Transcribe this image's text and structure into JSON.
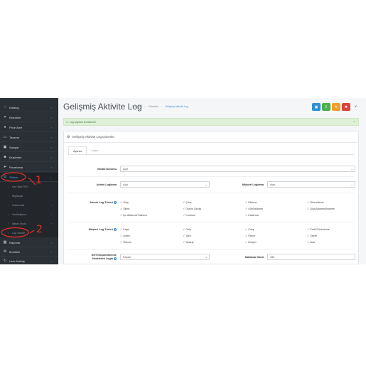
{
  "sidebar": {
    "items": [
      {
        "label": "Katalog",
        "icon": "tag-icon"
      },
      {
        "label": "Eklentiler",
        "icon": "puzzle-icon"
      },
      {
        "label": "Price Alert",
        "icon": "bell-icon"
      },
      {
        "label": "Tasarım",
        "icon": "monitor-icon"
      },
      {
        "label": "Satışlar",
        "icon": "cart-icon"
      },
      {
        "label": "Müşteriler",
        "icon": "user-icon"
      },
      {
        "label": "Pazarlama",
        "icon": "share-icon"
      },
      {
        "label": "Sistem",
        "icon": "gear-icon"
      }
    ],
    "sub_items": [
      {
        "label": "Key Yard PRO"
      },
      {
        "label": "Bilgisayar"
      },
      {
        "label": "Kullanıcılar"
      },
      {
        "label": "Yerelleştirme"
      },
      {
        "label": "Bakım Modu"
      },
      {
        "label": "Log Yazılım"
      }
    ],
    "bottom_items": [
      {
        "label": "Raporlar",
        "icon": "bar-chart-icon"
      },
      {
        "label": "Modüller",
        "icon": "gear-icon"
      },
      {
        "label": "User Activity",
        "icon": "history-icon"
      }
    ]
  },
  "header": {
    "title": "Gelişmiş Aktivite Log",
    "breadcrumb": [
      "Anasayfa",
      "Eklentiler",
      "Gelişmiş Aktivite Log"
    ]
  },
  "alert": {
    "text": "Log kayıtları temizlendi!"
  },
  "panel": {
    "title": "Gelişmiş Aktivite Log Düzenle"
  },
  "tabs": [
    {
      "label": "Ayarlar"
    },
    {
      "label": "Loglar"
    }
  ],
  "form": {
    "module_status": {
      "label": "Modül Durumu",
      "value": "Açık"
    },
    "admin_logging": {
      "label": "Admin Loglama",
      "value": "Açık"
    },
    "customer_logging": {
      "label": "Müşteri Loglama",
      "value": "Açık"
    },
    "admin_log_types": {
      "label": "Admin Log Türleri",
      "options": [
        "Giriş",
        "Çıkış",
        "Ekleme",
        "Güncelleme",
        "Silme",
        "Durum Geçişi",
        "Görüntüleme",
        "Dışa Aktarma/İndirme",
        "İçe Aktarma/Yükleme",
        "Kurulum",
        "Kaldırma"
      ]
    },
    "customer_log_types": {
      "label": "Müşteri Log Türleri",
      "options": [
        "Kayıt",
        "Giriş",
        "Çıkış",
        "Profil Düzenleme",
        "Adres",
        "Şifre",
        "Favori",
        "Sepet",
        "Ödeme",
        "Sipariş",
        "İletişim",
        "İade"
      ]
    },
    "get_post": {
      "label_line1": "GET/Gönderilmeme",
      "label_line2": "İsteklerini Logla",
      "value": "Kapalı"
    },
    "retention": {
      "label": "Saklama Günü",
      "value": "180"
    }
  },
  "annotations": {
    "mark_1": "1",
    "mark_2": "2"
  },
  "colors": {
    "sidebar_bg": "#2b3036",
    "accent": "#3a8fd8",
    "btn_blue": "#2f8fd6",
    "btn_green": "#4cae4c",
    "btn_orange": "#f0a030",
    "btn_red": "#d9443d",
    "annotation": "#e0302a"
  }
}
